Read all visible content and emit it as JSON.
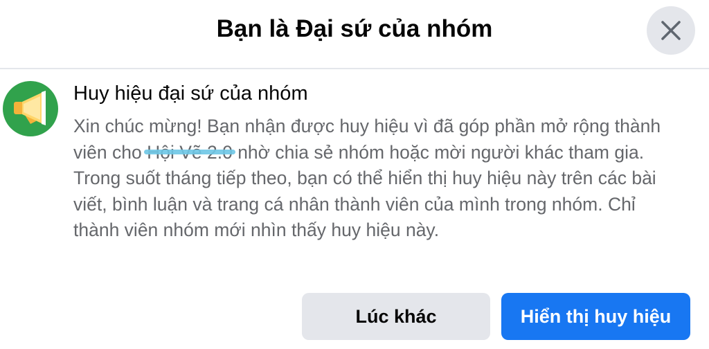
{
  "dialog": {
    "title": "Bạn là Đại sứ của nhóm",
    "close_icon": "close-icon"
  },
  "badge": {
    "icon": "megaphone-icon",
    "icon_color": "#31a24c",
    "title": "Huy hiệu đại sứ của nhóm",
    "description_part1": "Xin chúc mừng! Bạn nhận được huy hiệu vì đã góp phần mở rộng thành viên cho ",
    "group_name": "Hội Vẽ 2.0",
    "description_part2": " nhờ chia sẻ nhóm hoặc mời người khác tham gia. Trong suốt tháng tiếp theo, bạn có thể hiển thị huy hiệu này trên các bài viết, bình luận và trang cá nhân thành viên của mình trong nhóm. Chỉ thành viên nhóm mới nhìn thấy huy hiệu này."
  },
  "actions": {
    "later_label": "Lúc khác",
    "show_label": "Hiển thị huy hiệu",
    "primary_color": "#1877f2"
  }
}
